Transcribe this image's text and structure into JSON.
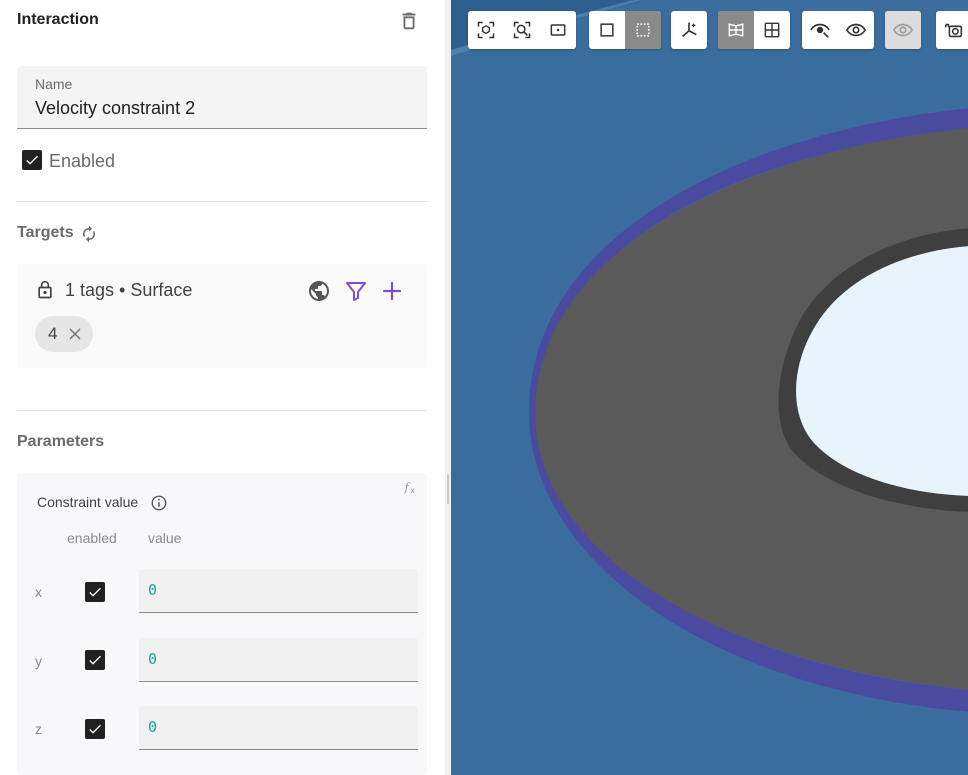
{
  "panel": {
    "title": "Interaction",
    "name_field": {
      "label": "Name",
      "value": "Velocity constraint 2"
    },
    "enabled": {
      "label": "Enabled",
      "checked": true
    },
    "targets": {
      "title": "Targets",
      "summary": "1 tags • Surface",
      "chips": [
        {
          "label": "4"
        }
      ]
    },
    "parameters": {
      "title": "Parameters",
      "constraint_label": "Constraint value",
      "columns": {
        "enabled": "enabled",
        "value": "value"
      },
      "rows": [
        {
          "axis": "x",
          "enabled": true,
          "value": "0"
        },
        {
          "axis": "y",
          "enabled": true,
          "value": "0"
        },
        {
          "axis": "z",
          "enabled": true,
          "value": "0"
        }
      ]
    }
  },
  "viewport": {
    "toolbar": [
      {
        "name": "view-group",
        "buttons": [
          "zoom-to-fit-icon",
          "zoom-to-selection-icon",
          "box-zoom-icon"
        ]
      },
      {
        "name": "selection-mode-group",
        "buttons": [
          "point-select-icon",
          "box-select-icon"
        ],
        "active": 1
      },
      {
        "name": "axes-group",
        "buttons": [
          "axes-icon"
        ]
      },
      {
        "name": "layout-group",
        "buttons": [
          "perspective-icon",
          "four-views-icon"
        ],
        "active": 0
      },
      {
        "name": "visibility-group",
        "buttons": [
          "hide-selection-icon",
          "show-all-icon"
        ]
      },
      {
        "name": "visibility-disabled-group",
        "buttons": [
          "hide-others-icon"
        ],
        "disabled": true
      },
      {
        "name": "screenshot-group",
        "buttons": [
          "screenshot-icon"
        ]
      }
    ],
    "colors": {
      "background": "#3a6d9e",
      "surface_top": "#5a5a5a",
      "surface_side": "#4a4aa0",
      "inner_hole": "#e8f4fc"
    }
  }
}
